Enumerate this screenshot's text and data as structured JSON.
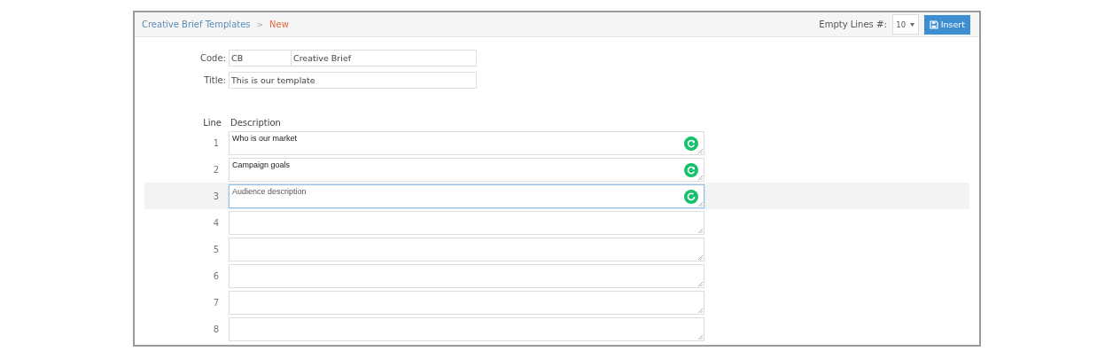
{
  "breadcrumb": {
    "parent": "Creative Brief Templates",
    "separator": ">",
    "current": "New"
  },
  "toolbar": {
    "empty_lines_label": "Empty Lines #:",
    "empty_lines_value": "10",
    "insert_button": "Insert"
  },
  "form": {
    "code_label": "Code:",
    "code_value": "CB",
    "code_name": "Creative Brief",
    "title_label": "Title:",
    "title_value": "This is our template"
  },
  "lines": {
    "columns": [
      "Line",
      "Description"
    ],
    "rows": [
      {
        "line": "1",
        "description": "Who is our market",
        "selected": false,
        "kind": "checked"
      },
      {
        "line": "2",
        "description": "Campaign goals",
        "selected": false,
        "kind": "checked"
      },
      {
        "line": "3",
        "description": "Audience description",
        "selected": true,
        "kind": "checking"
      },
      {
        "line": "4",
        "selected": false
      },
      {
        "line": "5",
        "selected": false
      },
      {
        "line": "6",
        "selected": false
      },
      {
        "line": "7",
        "selected": false
      },
      {
        "line": "8",
        "selected": false
      }
    ]
  }
}
